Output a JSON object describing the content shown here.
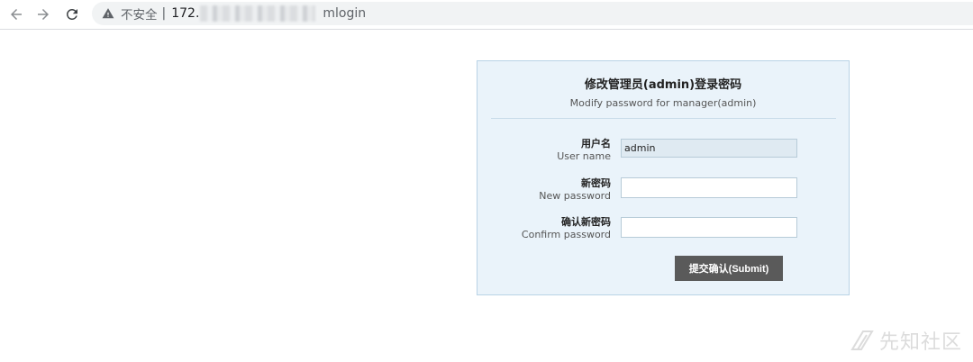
{
  "browser": {
    "insecure_label": "不安全",
    "separator": "|",
    "url_host": "172.",
    "url_path": "mlogin"
  },
  "form": {
    "title": "修改管理员(admin)登录密码",
    "subtitle": "Modify password for manager(admin)",
    "fields": [
      {
        "label_cn": "用户名",
        "label_en": "User name",
        "value": "admin"
      },
      {
        "label_cn": "新密码",
        "label_en": "New password",
        "value": ""
      },
      {
        "label_cn": "确认新密码",
        "label_en": "Confirm password",
        "value": ""
      }
    ],
    "submit_label": "提交确认(Submit)"
  },
  "watermark": {
    "text": "先知社区"
  },
  "colors": {
    "panel_bg": "#eaf3fa",
    "panel_border": "#b9d3e6",
    "button_bg": "#5a5a5a"
  }
}
